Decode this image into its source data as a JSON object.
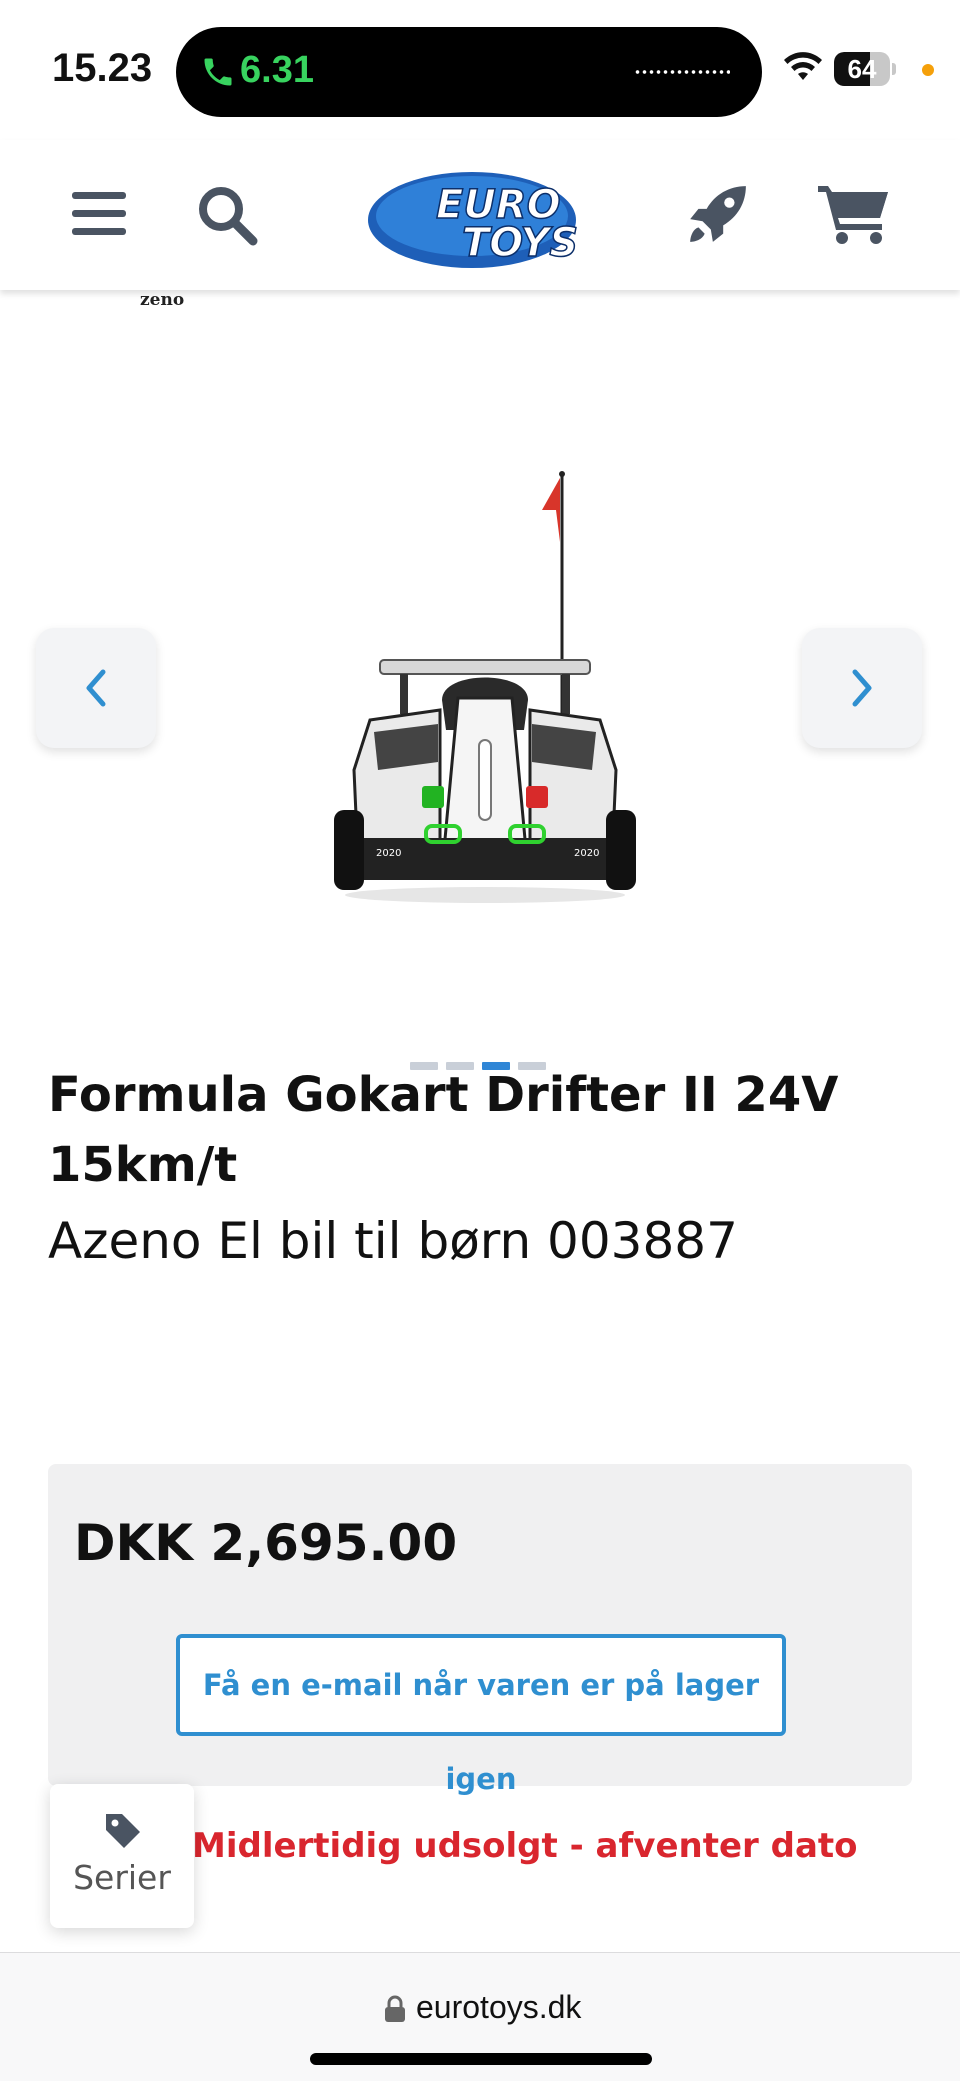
{
  "status_bar": {
    "time": "15.23",
    "call_duration": "6.31",
    "battery_level": "64",
    "battery_fraction": 0.64
  },
  "header": {
    "logo_line1": "EURO",
    "logo_line2": "TOYS",
    "icons": [
      "menu-icon",
      "search-icon",
      "rocket-icon",
      "cart-icon"
    ]
  },
  "gallery": {
    "brand": "zeno",
    "slide_count": 4,
    "active_slide": 3,
    "product_livery_text": "2020"
  },
  "product": {
    "title": "Formula Gokart Drifter II 24V 15km/t",
    "subtitle": "Azeno El bil til børn 003887",
    "price": "DKK 2,695.00",
    "notify_button": "Få en e-mail når varen er på lager igen",
    "stock_status": "Midlertidig udsolgt - afventer dato"
  },
  "floating": {
    "series_label": "Serier"
  },
  "browser": {
    "url": "eurotoys.dk"
  },
  "colors": {
    "accent_blue": "#2f8fd0",
    "stock_red": "#d9262e",
    "call_green": "#38d35f",
    "icon_gray": "#4a5462"
  }
}
